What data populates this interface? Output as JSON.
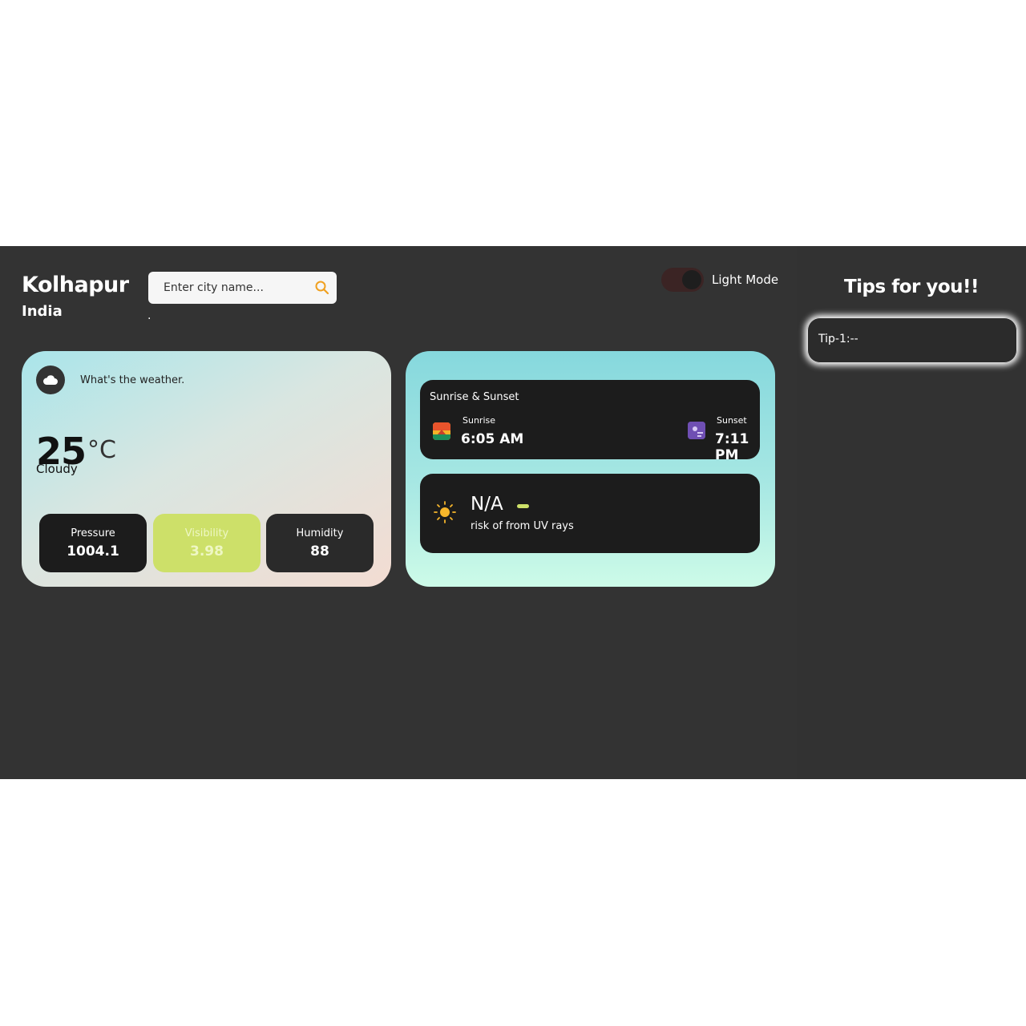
{
  "location": {
    "city": "Kolhapur",
    "country": "India",
    "dot": "."
  },
  "search": {
    "placeholder": "Enter city name..."
  },
  "theme_toggle": {
    "label": "Light Mode"
  },
  "weather": {
    "prompt": "What's the weather.",
    "temperature": "25",
    "unit": "°C",
    "condition": "Cloudy",
    "stats": [
      {
        "label": "Pressure",
        "value": "1004.1"
      },
      {
        "label": "Visibility",
        "value": "3.98"
      },
      {
        "label": "Humidity",
        "value": "88"
      }
    ]
  },
  "sun": {
    "title": "Sunrise & Sunset",
    "sunrise_label": "Sunrise",
    "sunrise_time": "6:05 AM",
    "sunset_label": "Sunset",
    "sunset_time": "7:11 PM"
  },
  "uv": {
    "value": "N/A",
    "description": "risk of from UV rays"
  },
  "tips": {
    "title": "Tips for you!!",
    "items": [
      "Tip-1:--"
    ]
  },
  "colors": {
    "background": "#333333",
    "accent_lime": "#cde069",
    "search_icon": "#f0a020",
    "card_dark": "#1c1c1c"
  },
  "icons": {
    "search": "search-icon",
    "weather": "cloud-icon",
    "sunrise": "sunrise-icon",
    "sunset": "sunset-icon",
    "uv": "sun-icon"
  }
}
